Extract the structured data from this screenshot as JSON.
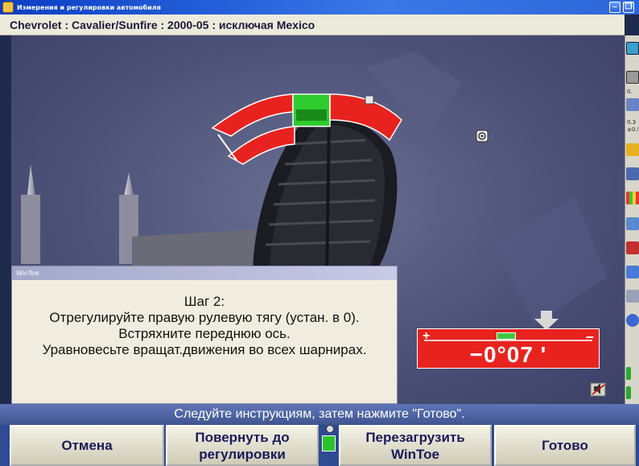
{
  "window": {
    "title": "Измерения и регулировки автомобиля",
    "vehicle": "Chevrolet : Cavalier/Sunfire : 2000-05 : исключая Mexico",
    "controls": [
      "minimize",
      "restore"
    ]
  },
  "sidebar": {
    "texts": [
      "0.",
      "0.3",
      "±0.!"
    ],
    "icons": [
      "help-icon",
      "monitor-icon",
      "measurement-icon",
      "tools-icon",
      "wrench-icon",
      "color-bars-icon",
      "vehicle-icon",
      "globe-icon",
      "gauge-icon"
    ]
  },
  "dialog": {
    "title": "WinToe",
    "step": "Шаг 2:",
    "lines": [
      "Отрегулируйте правую рулевую тягу (устан. в 0).",
      "Встряхните переднюю ось.",
      "Уравновесьте вращат.движения во всех шарнирах."
    ]
  },
  "readout": {
    "plus": "+",
    "minus": "−",
    "value": "−0°07 '",
    "color": "#e8231f"
  },
  "instruction": "Следуйте инструкциям, затем нажмите \"Готово\".",
  "buttons": {
    "cancel": "Отмена",
    "rotate": "Повернуть до регулировки",
    "reload": "Перезагрузить WinToe",
    "done": "Готово"
  },
  "colors": {
    "in_range": "#2ecc2e",
    "out_of_range": "#e8231f"
  }
}
